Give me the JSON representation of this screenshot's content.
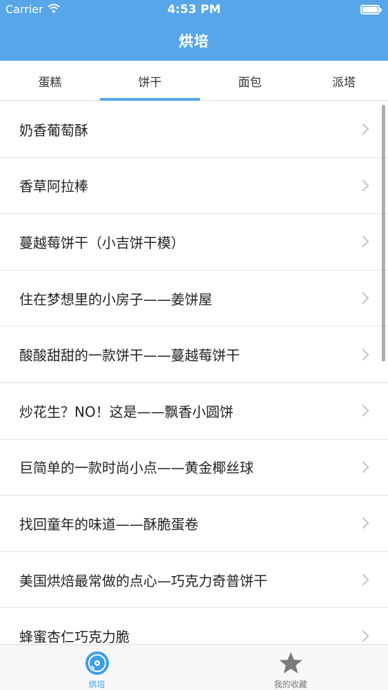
{
  "status_bar": {
    "carrier": "Carrier",
    "time": "4:53 PM"
  },
  "nav": {
    "title": "烘培"
  },
  "tabs": [
    {
      "label": "蛋糕"
    },
    {
      "label": "饼干"
    },
    {
      "label": "面包"
    },
    {
      "label": "派塔"
    }
  ],
  "selected_tab": "饼干",
  "list": {
    "items": [
      {
        "title": "奶香葡萄酥"
      },
      {
        "title": "香草阿拉棒"
      },
      {
        "title": "蔓越莓饼干（小吉饼干模）"
      },
      {
        "title": "住在梦想里的小房子——姜饼屋"
      },
      {
        "title": "酸酸甜甜的一款饼干——蔓越莓饼干"
      },
      {
        "title": "炒花生？NO！这是——飘香小圆饼"
      },
      {
        "title": "巨简单的一款时尚小点——黄金椰丝球"
      },
      {
        "title": "找回童年的味道——酥脆蛋卷"
      },
      {
        "title": "美国烘焙最常做的点心—巧克力奇普饼干"
      },
      {
        "title": "蜂蜜杏仁巧克力脆"
      }
    ]
  },
  "tab_bar": {
    "items": [
      {
        "label": "烘培",
        "icon": "disc-icon",
        "active": true
      },
      {
        "label": "我的收藏",
        "icon": "star-icon",
        "active": false
      }
    ]
  },
  "colors": {
    "accent": "#56a6e9",
    "active_tab_label": "#3d9ee9",
    "inactive_tab_label": "#777777",
    "chevron": "#c2c2c7"
  }
}
